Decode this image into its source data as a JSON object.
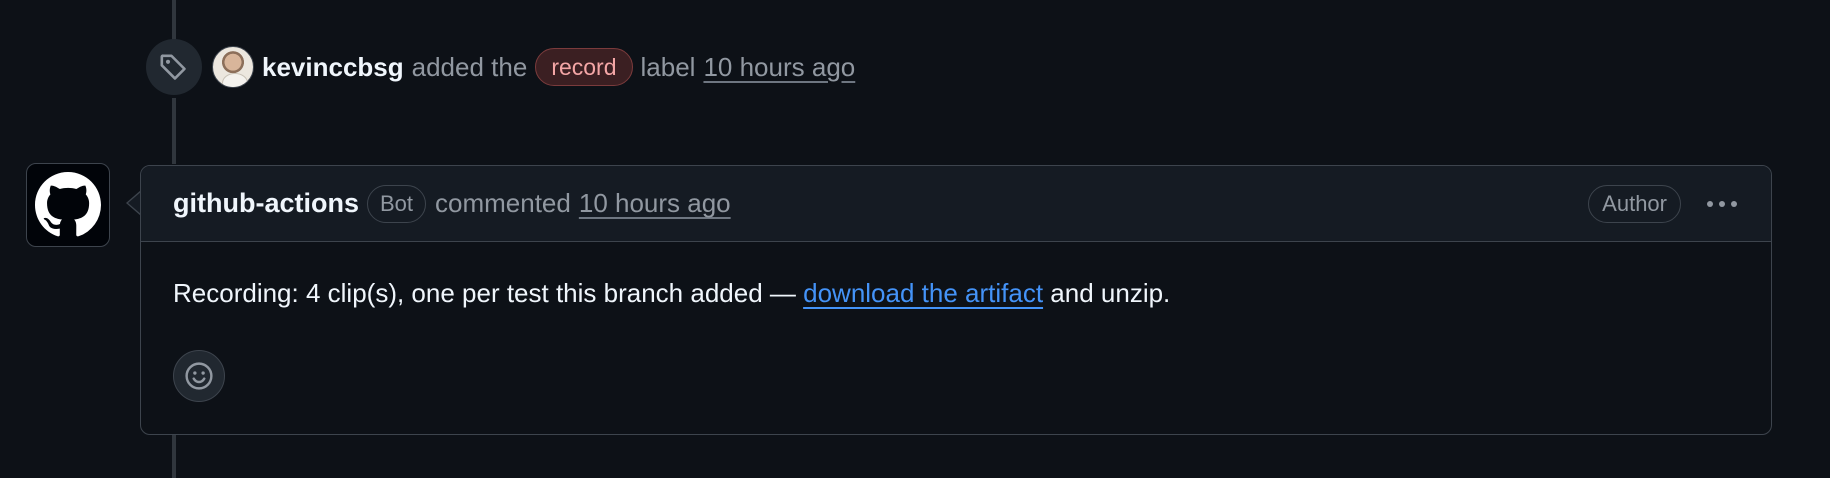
{
  "label_event": {
    "icon": "tag-icon",
    "user": "kevinccbsg",
    "action_text": "added the",
    "label_name": "record",
    "label_suffix": "label",
    "time": "10 hours ago"
  },
  "comment": {
    "author": "github-actions",
    "author_badge": "Bot",
    "action_text": "commented",
    "time": "10 hours ago",
    "role_badge": "Author",
    "more_icon": "kebab-horizontal-icon",
    "body_prefix": "Recording: 4 clip(s), one per test this branch added —",
    "body_link": "download the artifact",
    "body_suffix": "and unzip.",
    "reaction_icon": "smiley-icon"
  },
  "colors": {
    "background": "#0d1117",
    "border": "#3d444d",
    "link": "#4493f8",
    "label_text": "#f4a6a6",
    "label_bg": "#3b1f22",
    "muted": "#9198a1"
  }
}
